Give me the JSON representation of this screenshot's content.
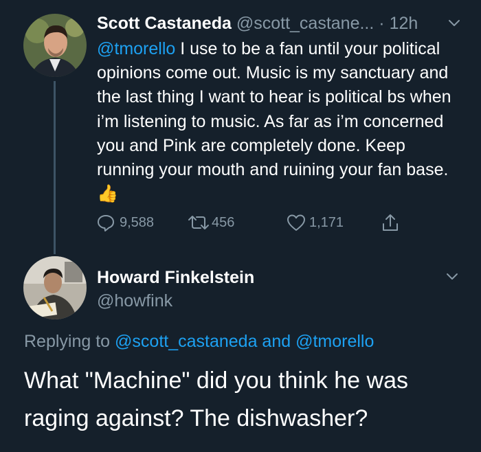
{
  "tweet1": {
    "author_name": "Scott Castaneda",
    "author_handle": "@scott_castane...",
    "separator": "·",
    "time": "12h",
    "mention": "@tmorello",
    "text": " I use to be a fan until your political opinions come out. Music is my sanctuary and the last thing I want to hear is political bs when i’m listening to music. As far as i’m concerned you and Pink are completely done. Keep running your mouth and ruining your fan base.",
    "emoji": "👍",
    "reply_count": "9,588",
    "retweet_count": "456",
    "like_count": "1,171"
  },
  "tweet2": {
    "author_name": "Howard Finkelstein",
    "author_handle": "@howfink",
    "replying_prefix": "Replying to ",
    "replying_user1": "@scott_castaneda",
    "replying_and": " and ",
    "replying_user2": "@tmorello",
    "text": "What \"Machine\" did you think he was raging against? The dishwasher?"
  },
  "colors": {
    "background": "#15202b",
    "link": "#1da1f2",
    "secondary_text": "#8899a6",
    "primary_text": "#ffffff"
  },
  "icons": {
    "reply": "speech-bubble-icon",
    "retweet": "retweet-icon",
    "like": "heart-icon",
    "share": "share-icon",
    "menu": "chevron-down-icon"
  }
}
